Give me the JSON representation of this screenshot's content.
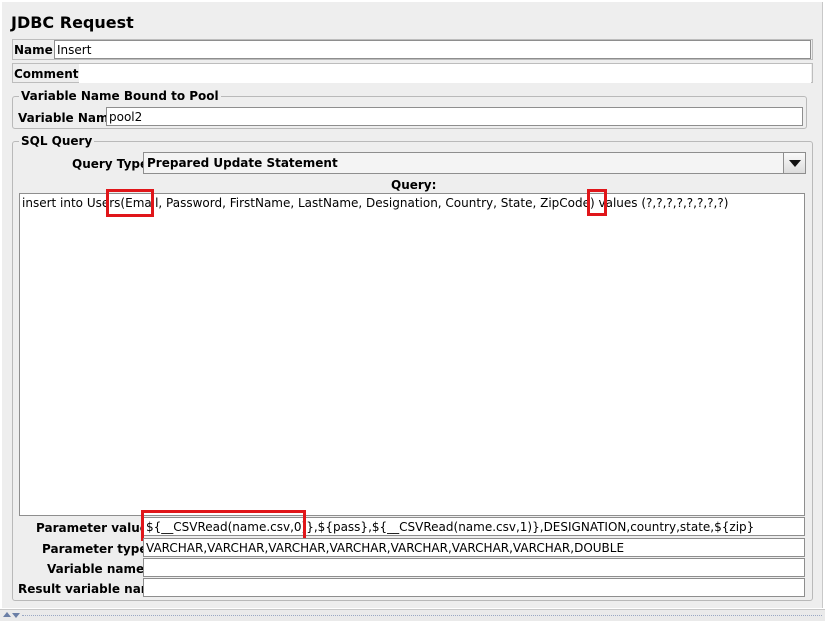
{
  "title": "JDBC Request",
  "name": {
    "label": "Name:",
    "value": "Insert"
  },
  "comments": {
    "label": "Comments:",
    "value": ""
  },
  "pool_group": {
    "legend": "Variable Name Bound to Pool",
    "label": "Variable Name:",
    "value": "pool2"
  },
  "sql_group": {
    "legend": "SQL Query",
    "query_type_label": "Query Type:",
    "query_type_value": "Prepared Update Statement",
    "query_label": "Query:",
    "query_text": "insert into Users(Email, Password, FirstName, LastName, Designation, Country, State, ZipCode) values (?,?,?,?,?,?,?,?)"
  },
  "params": {
    "values_label": "Parameter values:",
    "values": "${__CSVRead(name.csv,0)},${pass},${__CSVRead(name.csv,1)},DESIGNATION,country,state,${zip}",
    "types_label": "Parameter types:",
    "types": "VARCHAR,VARCHAR,VARCHAR,VARCHAR,VARCHAR,VARCHAR,VARCHAR,DOUBLE",
    "var_names_label": "Variable names:",
    "var_names": "",
    "result_var_label": "Result variable name:",
    "result_var": ""
  },
  "colors": {
    "highlight": "#e0161a",
    "panel": "#eeeeee"
  }
}
